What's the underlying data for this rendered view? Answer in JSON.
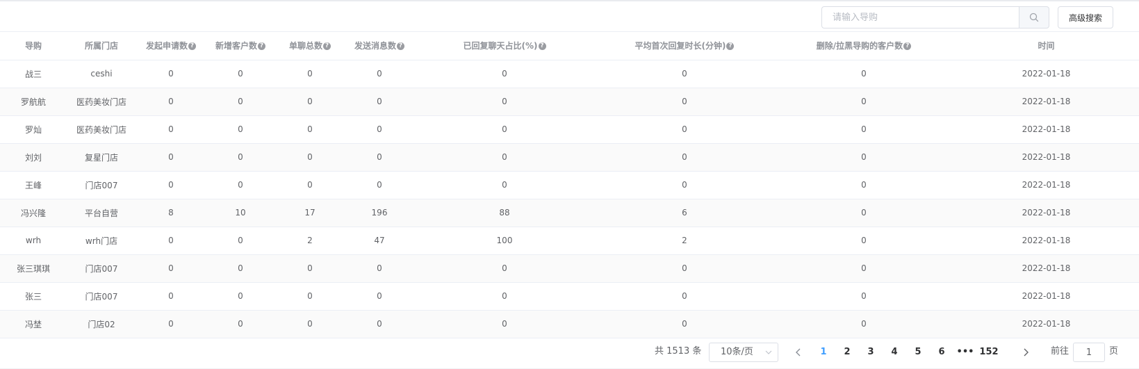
{
  "search": {
    "placeholder": "请输入导购"
  },
  "advanced_search_label": "高级搜索",
  "table": {
    "columns": [
      "导购",
      "所属门店",
      "发起申请数",
      "新增客户数",
      "单聊总数",
      "发送消息数",
      "已回复聊天占比(%)",
      "平均首次回复时长(分钟)",
      "删除/拉黑导购的客户数",
      "时间"
    ],
    "help_icon_char": "?",
    "rows": [
      [
        "战三",
        "ceshi",
        "0",
        "0",
        "0",
        "0",
        "0",
        "0",
        "0",
        "2022-01-18"
      ],
      [
        "罗航航",
        "医药美妆门店",
        "0",
        "0",
        "0",
        "0",
        "0",
        "0",
        "0",
        "2022-01-18"
      ],
      [
        "罗灿",
        "医药美妆门店",
        "0",
        "0",
        "0",
        "0",
        "0",
        "0",
        "0",
        "2022-01-18"
      ],
      [
        "刘刘",
        "复星门店",
        "0",
        "0",
        "0",
        "0",
        "0",
        "0",
        "0",
        "2022-01-18"
      ],
      [
        "王峰",
        "门店007",
        "0",
        "0",
        "0",
        "0",
        "0",
        "0",
        "0",
        "2022-01-18"
      ],
      [
        "冯兴隆",
        "平台自营",
        "8",
        "10",
        "17",
        "196",
        "88",
        "6",
        "0",
        "2022-01-18"
      ],
      [
        "wrh",
        "wrh门店",
        "0",
        "0",
        "2",
        "47",
        "100",
        "2",
        "0",
        "2022-01-18"
      ],
      [
        "张三琪琪",
        "门店007",
        "0",
        "0",
        "0",
        "0",
        "0",
        "0",
        "0",
        "2022-01-18"
      ],
      [
        "张三",
        "门店007",
        "0",
        "0",
        "0",
        "0",
        "0",
        "0",
        "0",
        "2022-01-18"
      ],
      [
        "冯埜",
        "门店02",
        "0",
        "0",
        "0",
        "0",
        "0",
        "0",
        "0",
        "2022-01-18"
      ]
    ]
  },
  "pagination": {
    "total_text": "共 1513 条",
    "page_size_label": "10条/页",
    "pages": [
      "1",
      "2",
      "3",
      "4",
      "5",
      "6",
      "•••",
      "152"
    ],
    "current_page": "1",
    "goto_prefix": "前往",
    "goto_value": "1",
    "goto_suffix": "页"
  },
  "icons": {
    "search": "search-icon",
    "help": "question-circle-icon",
    "prev": "chevron-left-icon",
    "next": "chevron-right-icon",
    "select_arrow": "chevron-down-icon"
  },
  "colors": {
    "accent": "#409eff",
    "header_text": "#909399",
    "body_text": "#606266",
    "stripe": "#fafafa"
  }
}
